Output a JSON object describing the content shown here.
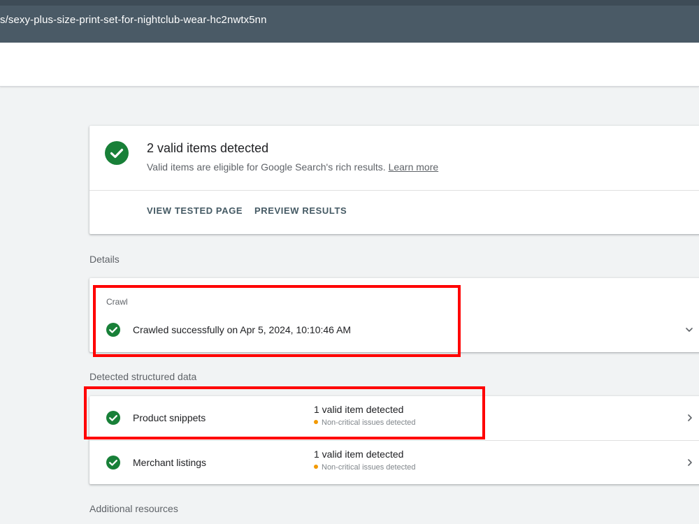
{
  "url_bar": {
    "text": "s/sexy-plus-size-print-set-for-nightclub-wear-hc2nwtx5nn"
  },
  "summary": {
    "title": "2 valid items detected",
    "subtitle": "Valid items are eligible for Google Search's rich results.",
    "learn_more": "Learn more",
    "actions": {
      "view_tested_page": "VIEW TESTED PAGE",
      "preview_results": "PREVIEW RESULTS"
    }
  },
  "details": {
    "heading": "Details",
    "crawl": {
      "label": "Crawl",
      "status": "Crawled successfully on Apr 5, 2024, 10:10:46 AM"
    }
  },
  "structured_data": {
    "heading": "Detected structured data",
    "items": [
      {
        "name": "Product snippets",
        "status": "1 valid item detected",
        "note": "Non-critical issues detected"
      },
      {
        "name": "Merchant listings",
        "status": "1 valid item detected",
        "note": "Non-critical issues detected"
      }
    ]
  },
  "additional": {
    "heading": "Additional resources"
  },
  "colors": {
    "valid_green": "#188038",
    "warning_orange": "#f29900",
    "annotation_red": "#ff0000",
    "topbar": "#4a5a66"
  },
  "icons": [
    "check-circle-icon",
    "chevron-down-icon",
    "chevron-right-icon",
    "warning-dot-icon"
  ]
}
